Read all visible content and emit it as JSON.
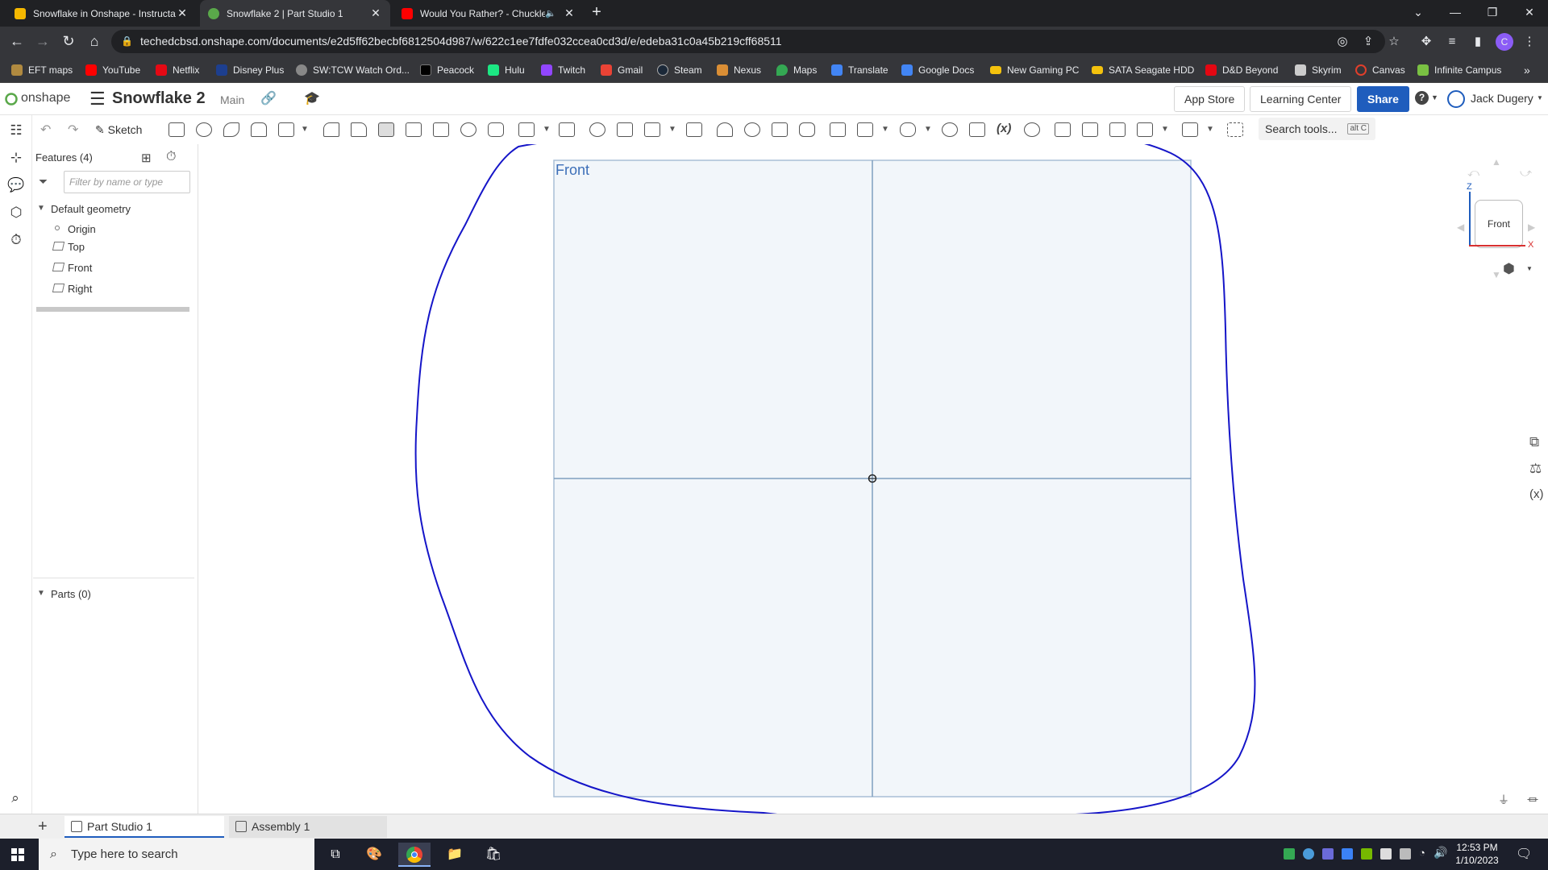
{
  "browser": {
    "tabs": [
      {
        "title": "Snowflake in Onshape - Instructa",
        "icon": "instructables-favicon",
        "color": "#f5b800"
      },
      {
        "title": "Snowflake 2 | Part Studio 1",
        "icon": "onshape-favicon",
        "color": "#5aa84a"
      },
      {
        "title": "Would You Rather? - Chuckle",
        "icon": "youtube-favicon",
        "color": "#ff0000"
      }
    ],
    "url": "techedcbsd.onshape.com/documents/e2d5ff62becbf6812504d987/w/622c1ee7fdfe032ccea0cd3d/e/edeba31c0a45b219cff68511",
    "profile_initial": "C",
    "bookmarks": [
      {
        "label": "EFT maps",
        "color": "#b08a40"
      },
      {
        "label": "YouTube",
        "color": "#ff0000"
      },
      {
        "label": "Netflix",
        "color": "#e50914"
      },
      {
        "label": "Disney Plus",
        "color": "#1d3f8f"
      },
      {
        "label": "SW:TCW Watch Ord...",
        "color": "#888888"
      },
      {
        "label": "Peacock",
        "color": "#000000"
      },
      {
        "label": "Hulu",
        "color": "#1ce783"
      },
      {
        "label": "Twitch",
        "color": "#9146ff"
      },
      {
        "label": "Gmail",
        "color": "#ea4335"
      },
      {
        "label": "Steam",
        "color": "#1b2838"
      },
      {
        "label": "Nexus",
        "color": "#da8e35"
      },
      {
        "label": "Maps",
        "color": "#34a853"
      },
      {
        "label": "Translate",
        "color": "#4285f4"
      },
      {
        "label": "Google Docs",
        "color": "#4285f4"
      },
      {
        "label": "New Gaming PC",
        "color": "#f4c20d"
      },
      {
        "label": "SATA Seagate HDD",
        "color": "#f4c20d"
      },
      {
        "label": "D&D Beyond",
        "color": "#e40712"
      },
      {
        "label": "Skyrim",
        "color": "#cccccc"
      },
      {
        "label": "Canvas",
        "color": "#e13f2b"
      },
      {
        "label": "Infinite Campus",
        "color": "#7ac143"
      }
    ],
    "bookmarks_more": "»"
  },
  "onshape": {
    "brand": "onshape",
    "doc_title": "Snowflake 2",
    "branch": "Main",
    "header_buttons": {
      "app_store": "App Store",
      "learning_center": "Learning Center",
      "share": "Share"
    },
    "user_name": "Jack Dugery",
    "accent": "#1f5dbd"
  },
  "toolbar": {
    "sketch_label": "Sketch",
    "search_tools_label": "Search tools...",
    "search_tools_shortcut": "alt C"
  },
  "feature_panel": {
    "features_header": "Features (4)",
    "filter_placeholder": "Filter by name or type",
    "default_geometry_label": "Default geometry",
    "items": [
      "Origin",
      "Top",
      "Front",
      "Right"
    ],
    "parts_header": "Parts (0)"
  },
  "viewport": {
    "plane_label": "Front",
    "view_cube_face": "Front",
    "axis_z": "Z",
    "axis_x": "X",
    "annotation_color": "#1515c8"
  },
  "bottom_tabs": [
    {
      "label": "Part Studio 1",
      "active": true
    },
    {
      "label": "Assembly 1",
      "active": false
    }
  ],
  "taskbar": {
    "search_placeholder": "Type here to search",
    "time": "12:53 PM",
    "date": "1/10/2023"
  }
}
